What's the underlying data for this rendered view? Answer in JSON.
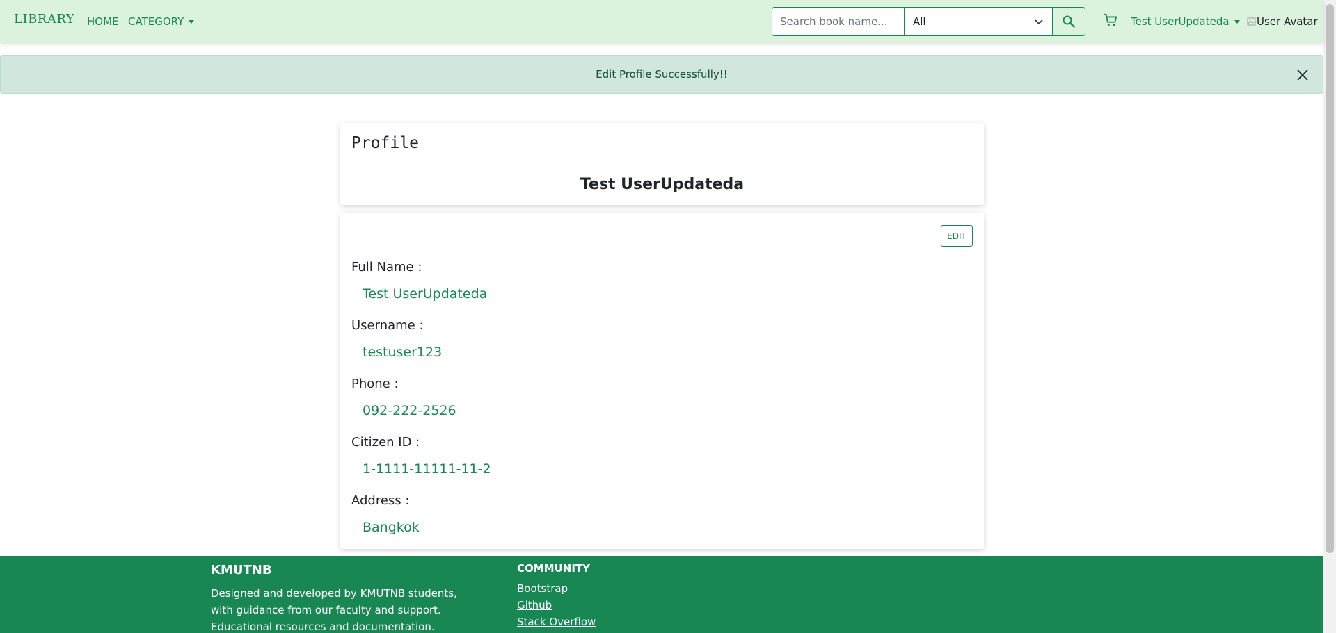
{
  "navbar": {
    "brand": "LIBRARY",
    "home": "HOME",
    "category": "CATEGORY",
    "search_placeholder": "Search book name...",
    "search_category": "All",
    "user_name": "Test UserUpdateda",
    "avatar_alt": "User Avatar"
  },
  "alert": {
    "message": "Edit Profile Successfully!!"
  },
  "profile": {
    "title": "Profile",
    "display_name": "Test UserUpdateda",
    "edit_label": "EDIT",
    "fields": [
      {
        "label": "Full Name :",
        "value": "Test UserUpdateda"
      },
      {
        "label": "Username :",
        "value": "testuser123"
      },
      {
        "label": "Phone :",
        "value": "092-222-2526"
      },
      {
        "label": "Citizen ID :",
        "value": "1-1111-11111-11-2"
      },
      {
        "label": "Address :",
        "value": "Bangkok"
      }
    ]
  },
  "footer": {
    "brand": "KMUTNB",
    "description": "Designed and developed by KMUTNB students, with guidance from our faculty and support. Educational resources and documentation.",
    "community_heading": "COMMUNITY",
    "links": [
      "Bootstrap",
      "Github",
      "Stack Overflow"
    ]
  },
  "colors": {
    "accent": "#198754",
    "navbar_bg": "#dbf2dd",
    "alert_bg": "#d1e7dd",
    "alert_text": "#0f5132"
  },
  "icons": {
    "search": "search-icon",
    "cart": "cart-icon",
    "close": "close-icon",
    "chevron": "chevron-down-icon",
    "avatar": "broken-image-icon"
  }
}
